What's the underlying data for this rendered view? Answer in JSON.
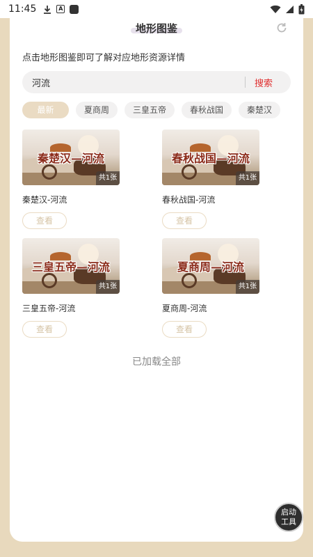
{
  "status_bar": {
    "time": "11:45",
    "left_icons": [
      "download-icon",
      "a-icon",
      "square-icon"
    ],
    "right_icons": [
      "wifi-icon",
      "signal-icon",
      "battery-icon"
    ]
  },
  "header": {
    "title": "地形图鉴",
    "refresh_icon": "refresh-icon"
  },
  "intro_text": "点击地形图鉴即可了解对应地形资源详情",
  "search": {
    "value": "河流",
    "button_label": "搜索",
    "accent_color": "#e02f2f"
  },
  "tabs": [
    {
      "label": "最新",
      "active": true
    },
    {
      "label": "夏商周",
      "active": false
    },
    {
      "label": "三皇五帝",
      "active": false
    },
    {
      "label": "春秋战国",
      "active": false
    },
    {
      "label": "秦楚汉",
      "active": false
    }
  ],
  "items": [
    {
      "thumb_text": "秦楚汉—河流",
      "count": "共1张",
      "title": "秦楚汉-河流",
      "button": "查看"
    },
    {
      "thumb_text": "春秋战国—河流",
      "count": "共1张",
      "title": "春秋战国-河流",
      "button": "查看"
    },
    {
      "thumb_text": "三皇五帝—河流",
      "count": "共1张",
      "title": "三皇五帝-河流",
      "button": "查看"
    },
    {
      "thumb_text": "夏商周—河流",
      "count": "共1张",
      "title": "夏商周-河流",
      "button": "查看"
    }
  ],
  "footer_text": "已加载全部",
  "fab": {
    "line1": "启动",
    "line2": "工具"
  },
  "colors": {
    "page_bg": "#e8d9bd",
    "tab_active": "#eadbc3",
    "view_button_text": "#d6c4a6"
  }
}
